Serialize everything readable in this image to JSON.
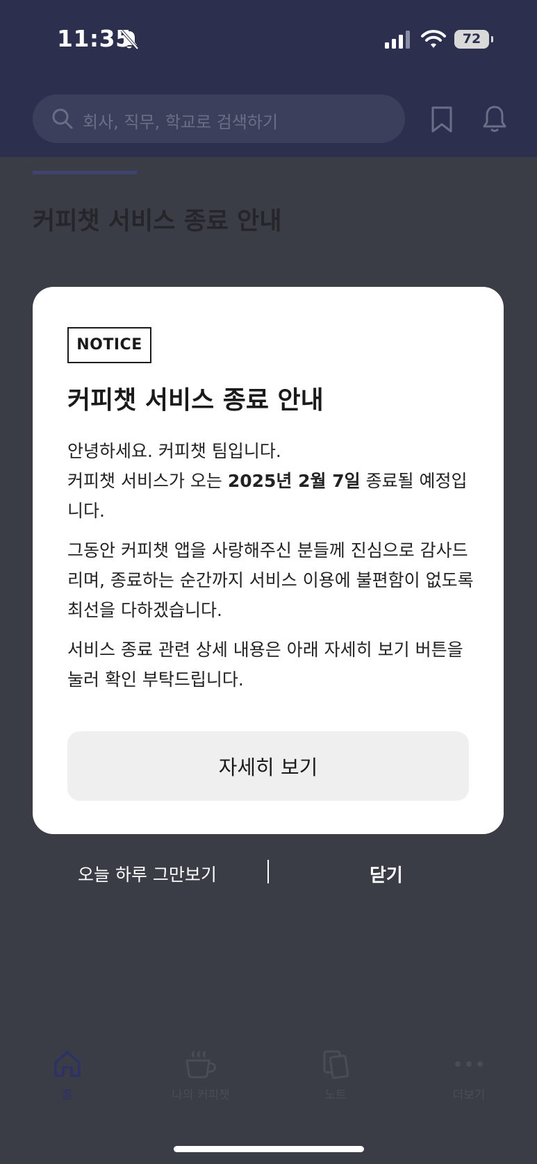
{
  "status_bar": {
    "time": "11:35",
    "battery": "72"
  },
  "search": {
    "placeholder": "회사, 직무, 학교로 검색하기"
  },
  "page": {
    "title": "커피챗 서비스 종료 안내"
  },
  "modal": {
    "badge": "NOTICE",
    "title": "커피챗 서비스 종료 안내",
    "p1_line1": "안녕하세요. 커피챗 팀입니다.",
    "p1_pre": "커피챗 서비스가 오는 ",
    "p1_date": "2025년 2월 7일",
    "p1_post": " 종료될 예정입니다.",
    "p2": "그동안 커피챗 앱을 사랑해주신 분들께 진심으로 감사드리며, 종료하는 순간까지 서비스 이용에 불편함이 없도록 최선을 다하겠습니다.",
    "p3": "서비스 종료 관련 상세 내용은 아래 자세히 보기 버튼을 눌러 확인 부탁드립니다.",
    "detail_button": "자세히 보기"
  },
  "actions": {
    "dismiss_today": "오늘 하루 그만보기",
    "close": "닫기"
  },
  "bottom_nav": {
    "home": "홈",
    "my_coffeechat": "나의 커피챗",
    "note": "노트",
    "more": "더보기"
  },
  "icons": {
    "status": [
      "bell-off-icon",
      "signal-icon",
      "wifi-icon",
      "battery-icon"
    ],
    "header": [
      "search-icon",
      "bookmark-icon",
      "bell-icon"
    ],
    "nav": [
      "home-icon",
      "coffee-cup-icon",
      "notes-icon",
      "more-dots-icon"
    ]
  },
  "colors": {
    "header_bg": "#2c2f4d",
    "overlay_bg": "#3a3c46",
    "modal_bg": "#ffffff",
    "button_bg": "#efefef",
    "nav_active": "#2d3266"
  }
}
